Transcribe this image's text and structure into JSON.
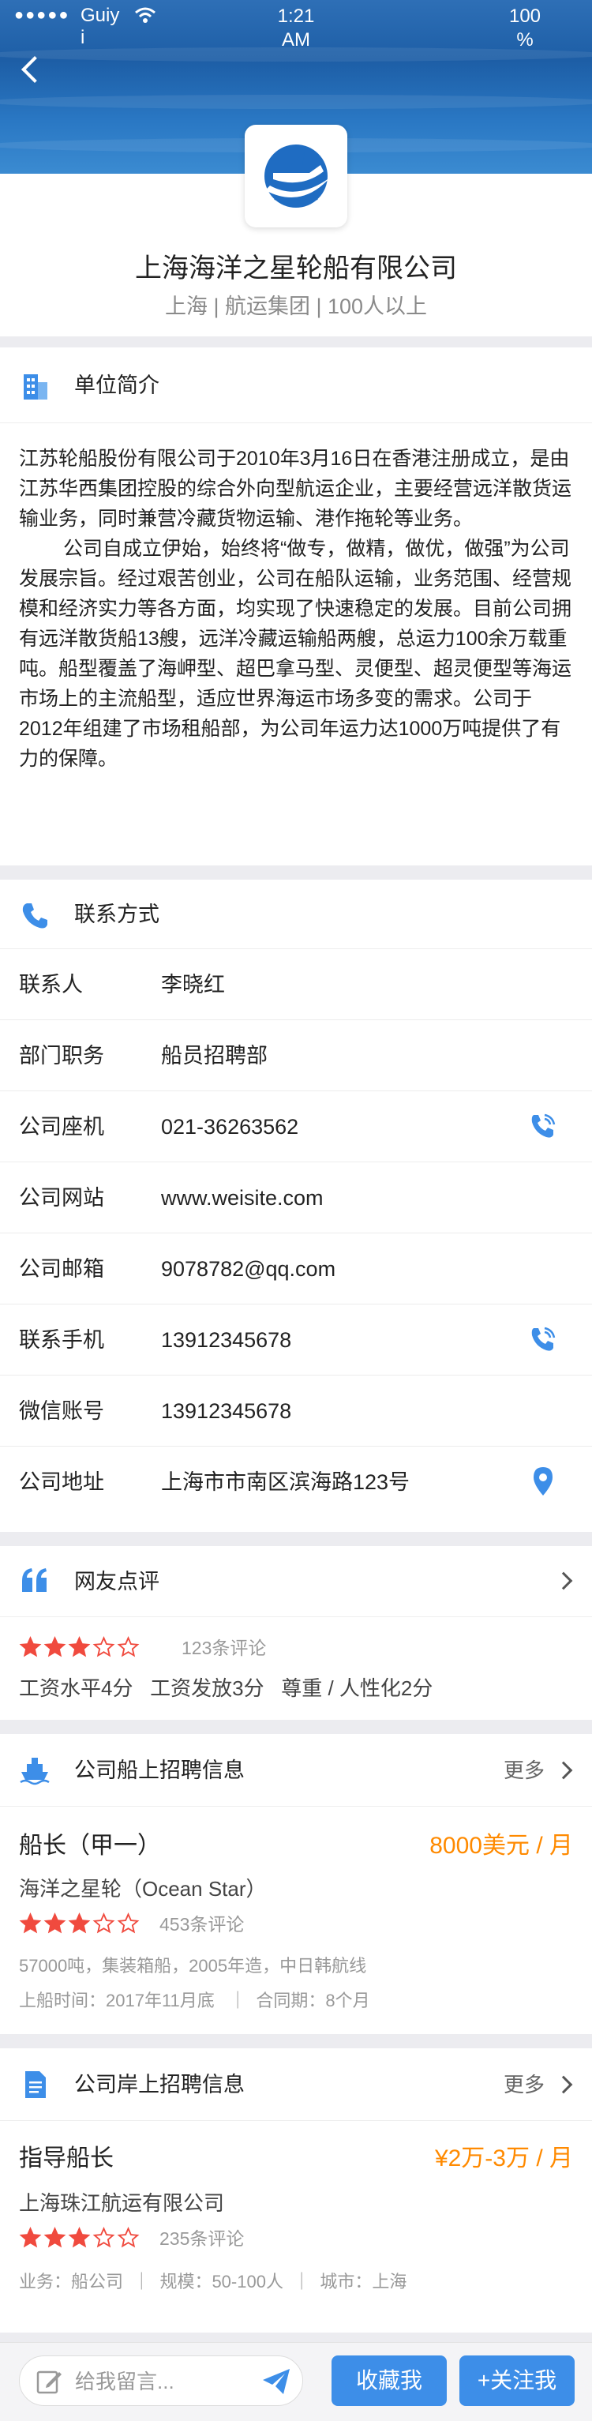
{
  "status_bar": {
    "dots": "●●●●●",
    "carrier": "Guiy\ni",
    "time": "1:21\nAM",
    "battery": "100\n%"
  },
  "company": {
    "name": "上海海洋之星轮船有限公司",
    "subtitle": "上海 | 航运集团 | 100人以上"
  },
  "intro": {
    "title": "单位简介",
    "p1": "江苏轮船股份有限公司于2010年3月16日在香港注册成立，是由江苏华西集团控股的综合外向型航运企业，主要经营远洋散货运输业务，同时兼营冷藏货物运输、港作拖轮等业务。",
    "p2": "公司自成立伊始，始终将“做专，做精，做优，做强”为公司发展宗旨。经过艰苦创业，公司在船队运输，业务范围、经营规模和经济实力等各方面，均实现了快速稳定的发展。目前公司拥有远洋散货船13艘，远洋冷藏运输船两艘，总运力100余万载重吨。船型覆盖了海岬型、超巴拿马型、灵便型、超灵便型等海运市场上的主流船型，适应世界海运市场多变的需求。公司于2012年组建了市场租船部，为公司年运力达1000万吨提供了有力的保障。"
  },
  "contact": {
    "title": "联系方式",
    "rows": [
      {
        "label": "联系人",
        "value": "李晓红"
      },
      {
        "label": "部门职务",
        "value": "船员招聘部"
      },
      {
        "label": "公司座机",
        "value": "021-36263562"
      },
      {
        "label": "公司网站",
        "value": "www.weisite.com"
      },
      {
        "label": "公司邮箱",
        "value": "9078782@qq.com"
      },
      {
        "label": "联系手机",
        "value": "13912345678"
      },
      {
        "label": "微信账号",
        "value": "13912345678"
      },
      {
        "label": "公司地址",
        "value": "上海市市南区滨海路123号"
      }
    ]
  },
  "comments": {
    "title": "网友点评",
    "rating": 3,
    "rating_max": 5,
    "count": "123条评论",
    "detail": "工资水平4分   工资发放3分   尊重 / 人性化2分"
  },
  "ship_jobs": {
    "title": "公司船上招聘信息",
    "more": "更多",
    "job": {
      "title": "船长（甲一）",
      "salary": "8000美元 / 月",
      "ship": "海洋之星轮（Ocean Star）",
      "rating": 3,
      "count": "453条评论",
      "specs": "57000吨，集装箱船，2005年造，中日韩航线",
      "dates": "上船时间：2017年11月底   ｜  合同期：8个月"
    }
  },
  "shore_jobs": {
    "title": "公司岸上招聘信息",
    "more": "更多",
    "job": {
      "title": "指导船长",
      "salary": "¥2万-3万 / 月",
      "company": "上海珠江航运有限公司",
      "rating": 3,
      "count": "235条评论",
      "meta": "业务：船公司  ｜  规模：50-100人  ｜  城市：上海"
    }
  },
  "bottom": {
    "placeholder": "给我留言...",
    "favorite": "收藏我",
    "follow": "+关注我"
  },
  "colors": {
    "accent": "#3d8ee8",
    "star": "#f04a3e",
    "salary": "#ff8a00"
  }
}
